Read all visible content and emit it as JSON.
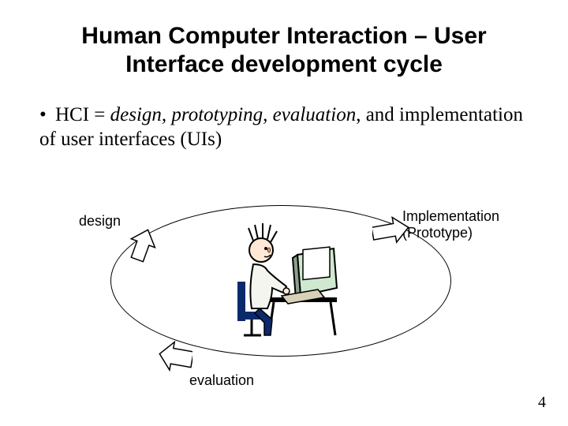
{
  "title_line1": "Human Computer Interaction – User",
  "title_line2": "Interface development cycle",
  "bullet_prefix": "HCI = ",
  "bullet_italic": "design, prototyping, evaluation",
  "bullet_suffix": ", and implementation of user interfaces (UIs)",
  "labels": {
    "design": "design",
    "impl_line1": "Implementation",
    "impl_line2": "(Prototype)",
    "evaluation": "evaluation"
  },
  "page_number": "4"
}
